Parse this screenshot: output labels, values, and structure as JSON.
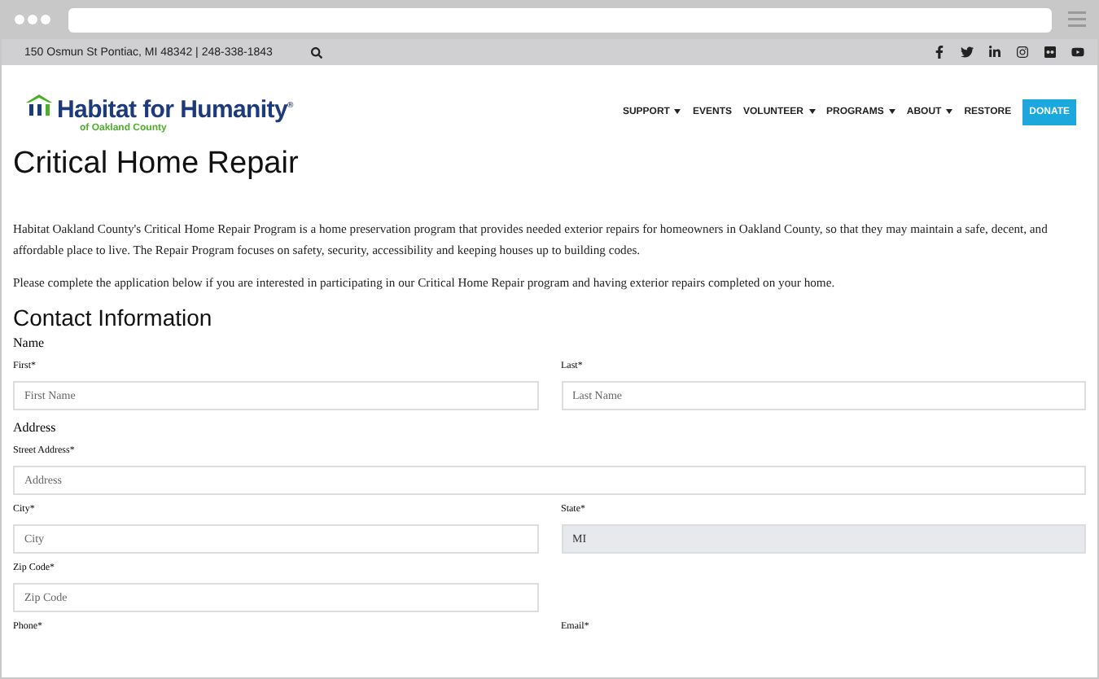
{
  "topbar": {
    "contact": "150 Osmun St Pontiac, MI 48342 | 248-338-1843"
  },
  "logo": {
    "name": "Habitat for Humanity",
    "registered": "®",
    "subtitle": "of Oakland County"
  },
  "nav": [
    {
      "label": "SUPPORT",
      "dropdown": true
    },
    {
      "label": "EVENTS",
      "dropdown": false
    },
    {
      "label": "VOLUNTEER",
      "dropdown": true
    },
    {
      "label": "PROGRAMS",
      "dropdown": true
    },
    {
      "label": "ABOUT",
      "dropdown": true
    },
    {
      "label": "RESTORE",
      "dropdown": false
    }
  ],
  "donate": "DONATE",
  "title": "Critical Home Repair",
  "paragraphs": [
    "Habitat Oakland County's Critical Home Repair Program is a home preservation program that provides needed exterior repairs for homeowners in Oakland County, so that they may maintain a safe, decent, and affordable place to live. The Repair Program focuses on safety, security, accessibility and keeping houses up to building codes.",
    "Please complete the application below if you are interested in participating in our Critical Home Repair program and having exterior repairs completed on your home."
  ],
  "section": "Contact Information",
  "groups": [
    {
      "label": "Name",
      "rows": [
        [
          {
            "label": "First*",
            "placeholder": "First Name",
            "disabled": false
          },
          {
            "label": "Last*",
            "placeholder": "Last Name",
            "disabled": false
          }
        ]
      ]
    },
    {
      "label": "Address",
      "rows": [
        [
          {
            "label": "Street Address*",
            "placeholder": "Address",
            "disabled": false
          }
        ],
        [
          {
            "label": "City*",
            "placeholder": "City",
            "disabled": false
          },
          {
            "label": "State*",
            "value": "MI",
            "disabled": true
          }
        ],
        [
          {
            "label": "Zip Code*",
            "placeholder": "Zip Code",
            "disabled": false
          },
          null
        ]
      ]
    },
    {
      "rows": [
        [
          {
            "label": "Phone*"
          },
          {
            "label": "Email*"
          }
        ]
      ]
    }
  ]
}
